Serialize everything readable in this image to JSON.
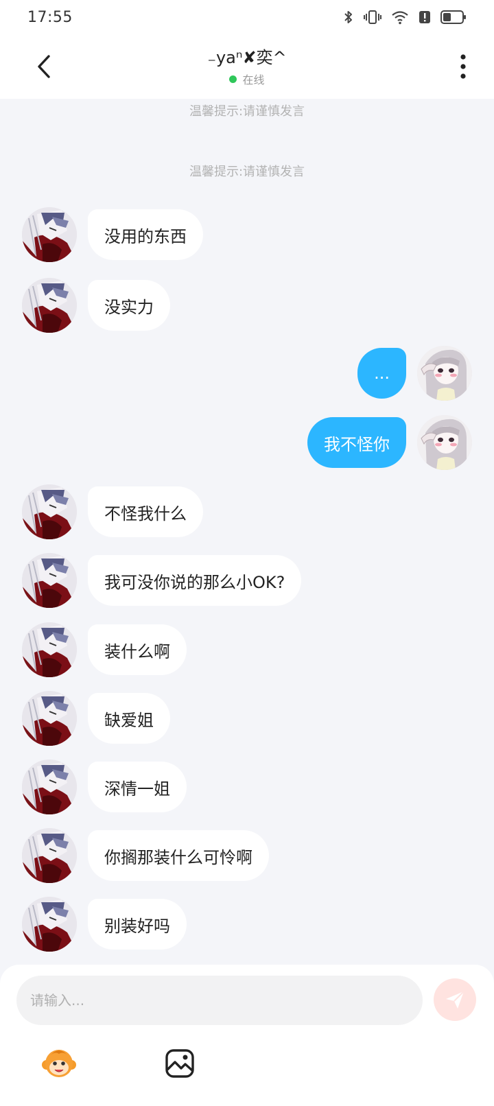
{
  "status_bar": {
    "time": "17:55",
    "icons": [
      "bluetooth-icon",
      "vibrate-icon",
      "wifi-icon",
      "alert-icon",
      "battery-icon"
    ]
  },
  "header": {
    "title": "₋yaⁿ✘奕^",
    "status": "在线",
    "status_color": "#2fc75a"
  },
  "chat": {
    "tips": [
      "温馨提示:请谨慎发言",
      "温馨提示:请谨慎发言"
    ],
    "messages": [
      {
        "side": "in",
        "text": "没用的东西"
      },
      {
        "side": "in",
        "text": "没实力"
      },
      {
        "side": "out",
        "text": "..."
      },
      {
        "side": "out",
        "text": "我不怪你"
      },
      {
        "side": "in",
        "text": "不怪我什么"
      },
      {
        "side": "in",
        "text": "我可没你说的那么小OK?"
      },
      {
        "side": "in",
        "text": "装什么啊"
      },
      {
        "side": "in",
        "text": "缺爱姐"
      },
      {
        "side": "in",
        "text": "深情一姐"
      },
      {
        "side": "in",
        "text": "你搁那装什么可怜啊"
      },
      {
        "side": "in",
        "text": "别装好吗"
      }
    ]
  },
  "input": {
    "placeholder": "请输入...",
    "send_icon": "send-icon"
  },
  "colors": {
    "accent": "#2cb6ff",
    "background": "#f4f5f9",
    "send_button": "#ffe3e0"
  }
}
